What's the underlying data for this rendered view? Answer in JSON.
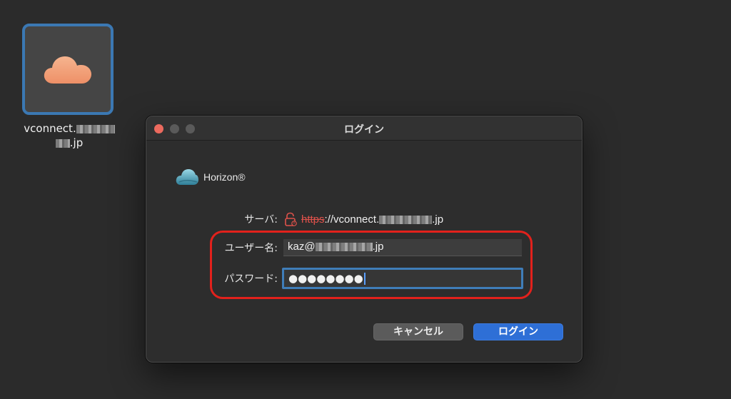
{
  "desktop": {
    "server_tile": {
      "icon": "cloud-icon",
      "caption_line1_prefix": "vconnect.",
      "caption_line2_suffix": ".jp"
    }
  },
  "dialog": {
    "title": "ログイン",
    "brand": {
      "name": "Horizon®",
      "icon": "horizon-logo-icon"
    },
    "server": {
      "label": "サーバ:",
      "lock_icon": "unlocked-padlock-icon",
      "scheme": "https",
      "rest_prefix": "://vconnect.",
      "rest_suffix": ".jp"
    },
    "username": {
      "label": "ユーザー名:",
      "value_prefix": "kaz@",
      "value_suffix": ".jp"
    },
    "password": {
      "label": "パスワード:",
      "masked_value": "●●●●●●●●"
    },
    "buttons": {
      "cancel": "キャンセル",
      "login": "ログイン"
    }
  },
  "colors": {
    "accent": "#2e6fd6",
    "highlight": "#e2211c",
    "https_insecure": "#e0524b",
    "tile_border": "#3b78b3",
    "cloud": "#f2a178"
  }
}
